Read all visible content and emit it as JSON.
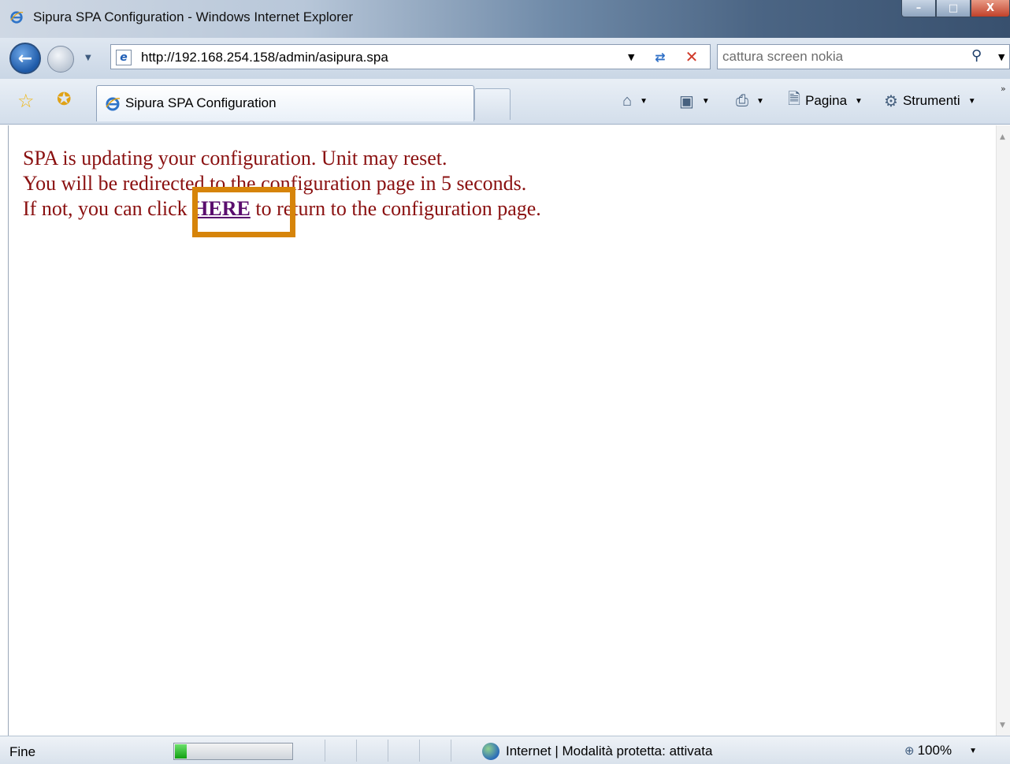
{
  "window": {
    "title": "Sipura SPA Configuration - Windows Internet Explorer",
    "minimize_label": "–",
    "maximize_label": "□",
    "close_label": "X"
  },
  "address_bar": {
    "url": "http://192.168.254.158/admin/asipura.spa"
  },
  "search": {
    "value": "cattura screen nokia"
  },
  "tabs": [
    {
      "label": "Sipura SPA Configuration",
      "active": true
    }
  ],
  "commands": {
    "page_label": "Pagina",
    "tools_label": "Strumenti"
  },
  "content": {
    "line1": "SPA is updating your configuration. Unit may reset.",
    "line2": "You will be redirected to the configuration page in 5 seconds.",
    "line3_before": "If not, you can click ",
    "link_text": "HERE",
    "line3_after": " to return to the configuration page.",
    "highlight_color": "#d6840a"
  },
  "status_bar": {
    "status_text": "Fine",
    "progress_fraction": 0.1,
    "zone_text": "Internet | Modalità protetta: attivata",
    "zoom_text": "100%"
  },
  "colors": {
    "message_text": "#8a1010",
    "link": "#5a0d6e"
  }
}
